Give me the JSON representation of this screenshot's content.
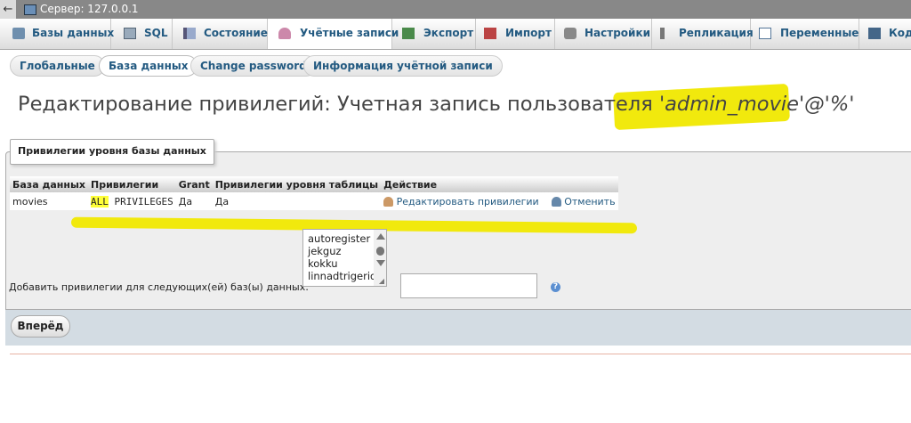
{
  "topbar": {
    "back": "←",
    "server_title": "Сервер: 127.0.0.1"
  },
  "tabs": [
    {
      "label": "Базы данных",
      "icon": "databases-icon"
    },
    {
      "label": "SQL",
      "icon": "sql-icon"
    },
    {
      "label": "Состояние",
      "icon": "status-icon"
    },
    {
      "label": "Учётные записи",
      "icon": "users-icon"
    },
    {
      "label": "Экспорт",
      "icon": "export-icon"
    },
    {
      "label": "Импорт",
      "icon": "import-icon"
    },
    {
      "label": "Настройки",
      "icon": "wrench-icon"
    },
    {
      "label": "Репликация",
      "icon": "replication-icon"
    },
    {
      "label": "Переменные",
      "icon": "variables-icon"
    },
    {
      "label": "Коди",
      "icon": "charset-icon"
    }
  ],
  "subtabs": [
    "Глобальные",
    "База данных",
    "Change password",
    "Информация учётной записи"
  ],
  "heading": {
    "prefix": "Редактирование привилегий: Учетная запись пользователя",
    "account": "'admin_movie'@'%'"
  },
  "section": {
    "legend": "Привилегии уровня базы данных"
  },
  "table": {
    "headers": [
      "База данных",
      "Привилегии",
      "Grant",
      "Привилегии уровня таблицы",
      "Действие"
    ],
    "row": {
      "database": "movies",
      "priv_all": "ALL",
      "priv_rest": " PRIVILEGES",
      "grant": "Да",
      "table_priv": "Да",
      "edit": "Редактировать привилегии",
      "revoke": "Отменить"
    }
  },
  "add": {
    "label": "Добавить привилегии для следующих(ей) баз(ы) данных:",
    "options": [
      "autoregister",
      "jekguz",
      "kokku",
      "linnadtrigerid"
    ],
    "input_value": "",
    "help": "?"
  },
  "submit": "Вперёд",
  "colors": {
    "link": "#235a81",
    "highlight": "#f0e800",
    "footer": "#d3dce3"
  }
}
